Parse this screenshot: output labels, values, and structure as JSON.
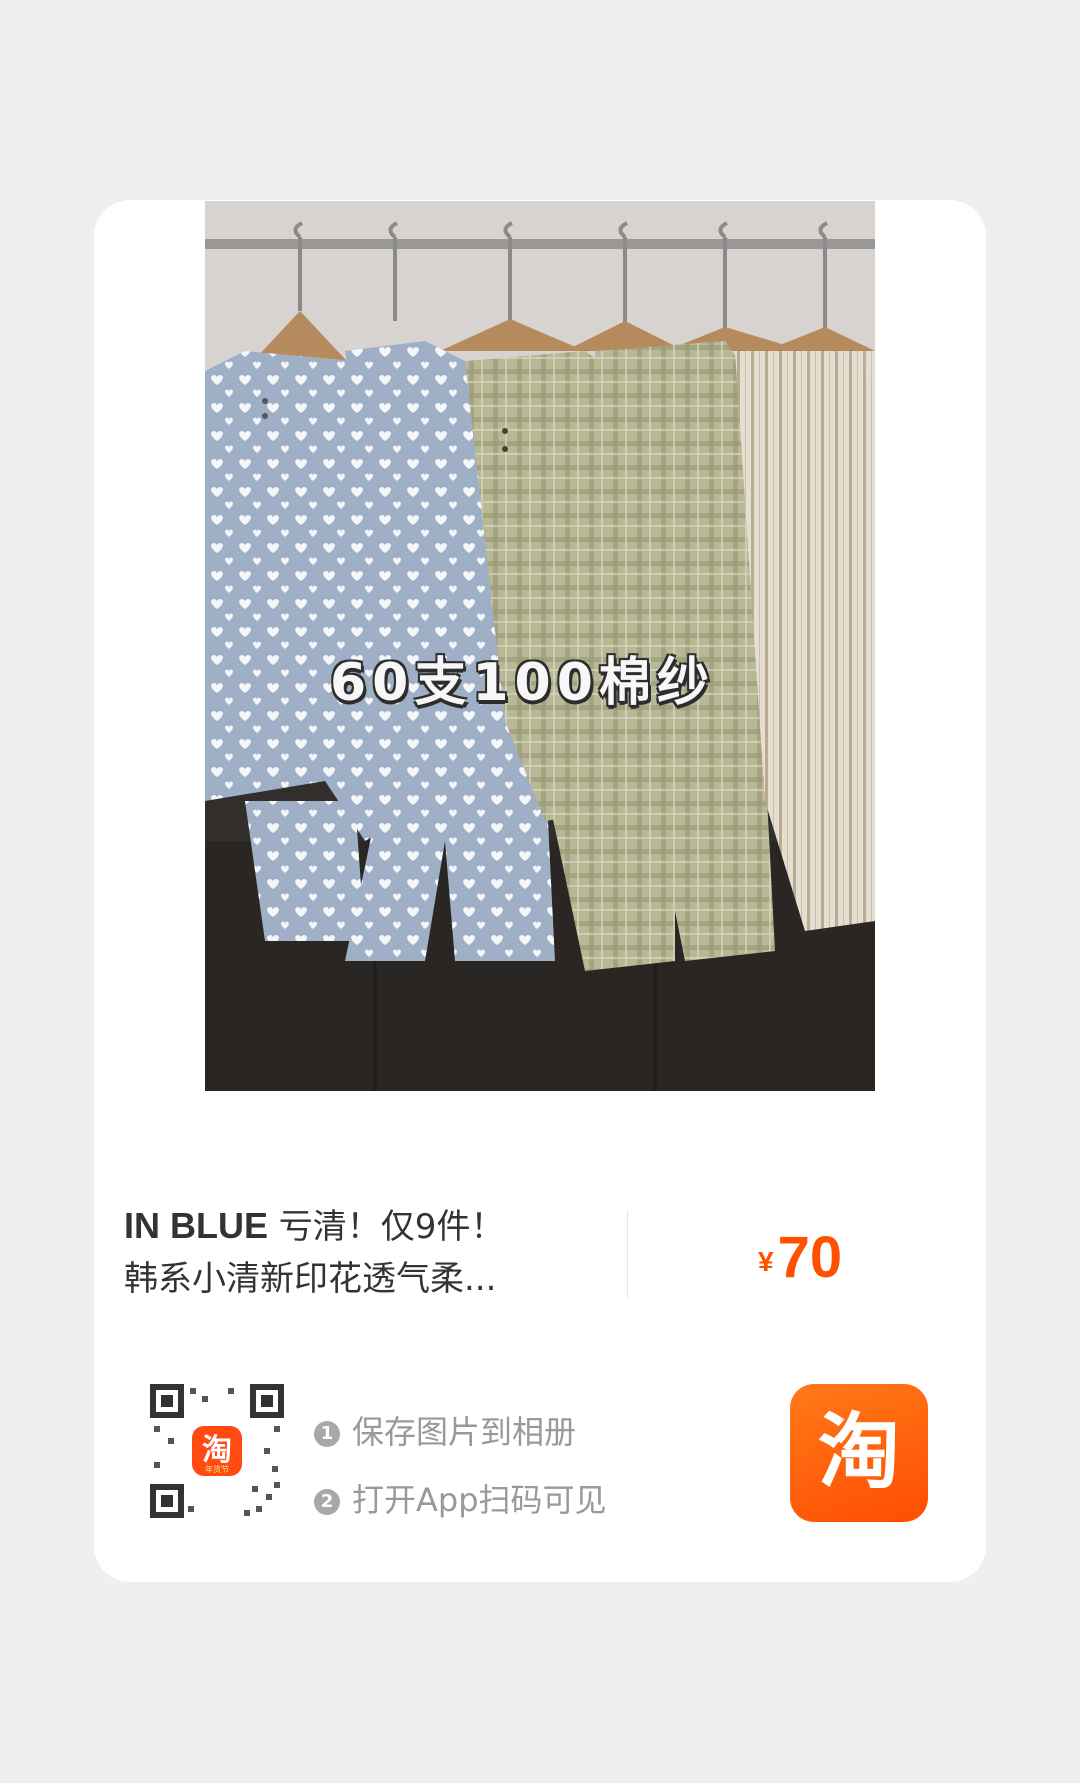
{
  "product": {
    "image_overlay": "60支100棉纱",
    "brand": "IN BLUE",
    "title_line1_rest": " 亏清！仅9件！",
    "title_line2": "韩系小清新印花透气柔...",
    "price_symbol": "¥",
    "price_value": "70"
  },
  "qr": {
    "center_logo_char": "淘",
    "center_logo_sub": "年货节"
  },
  "steps": [
    {
      "num": "1",
      "text": "保存图片到相册"
    },
    {
      "num": "2",
      "text": "打开App扫码可见"
    }
  ],
  "app_icon": {
    "char": "淘",
    "icon": "taobao-app-icon"
  },
  "colors": {
    "accent": "#ff5000",
    "muted": "#999999",
    "card": "#ffffff",
    "background": "#efefef"
  }
}
